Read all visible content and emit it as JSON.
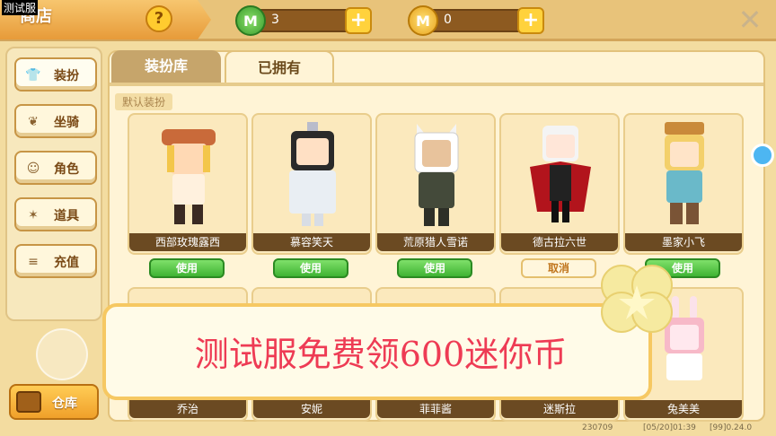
{
  "overlay_label": "测试服",
  "shop": {
    "title": "商店",
    "help": "?"
  },
  "currency": {
    "gem_value": "3",
    "coin_value": "0",
    "gem_symbol": "M",
    "coin_symbol": "M",
    "plus": "+"
  },
  "close": "✕",
  "sidebar": {
    "items": [
      {
        "label": "装扮",
        "icon": "shirt-icon",
        "glyph": "👕"
      },
      {
        "label": "坐骑",
        "icon": "wings-icon",
        "glyph": "❦"
      },
      {
        "label": "角色",
        "icon": "cat-face-icon",
        "glyph": "☺"
      },
      {
        "label": "道具",
        "icon": "confetti-icon",
        "glyph": "✶"
      },
      {
        "label": "充值",
        "icon": "coins-icon",
        "glyph": "≡"
      }
    ],
    "warehouse": "仓库"
  },
  "tabs": {
    "library": "装扮库",
    "owned": "已拥有"
  },
  "section": "默认装扮",
  "cards_row1": [
    {
      "name": "西部玫瑰露西",
      "action": "使用",
      "action_type": "use"
    },
    {
      "name": "慕容笑天",
      "action": "使用",
      "action_type": "use"
    },
    {
      "name": "荒原猎人雪诺",
      "action": "使用",
      "action_type": "use"
    },
    {
      "name": "德古拉六世",
      "action": "取消",
      "action_type": "cancel"
    },
    {
      "name": "墨家小飞",
      "action": "使用",
      "action_type": "use"
    }
  ],
  "cards_row2": [
    {
      "name": "乔治"
    },
    {
      "name": "安妮"
    },
    {
      "name": "菲菲酱"
    },
    {
      "name": "迷斯拉"
    },
    {
      "name": "兔美美"
    }
  ],
  "promo": "测试服免费领600迷你币",
  "footer": {
    "build": "230709",
    "date": "[05/20]01:39",
    "version": "[99]0.24.0"
  },
  "colors": {
    "accent": "#e79b39",
    "use_green": "#3fb333",
    "promo_red": "#ee3b54"
  }
}
